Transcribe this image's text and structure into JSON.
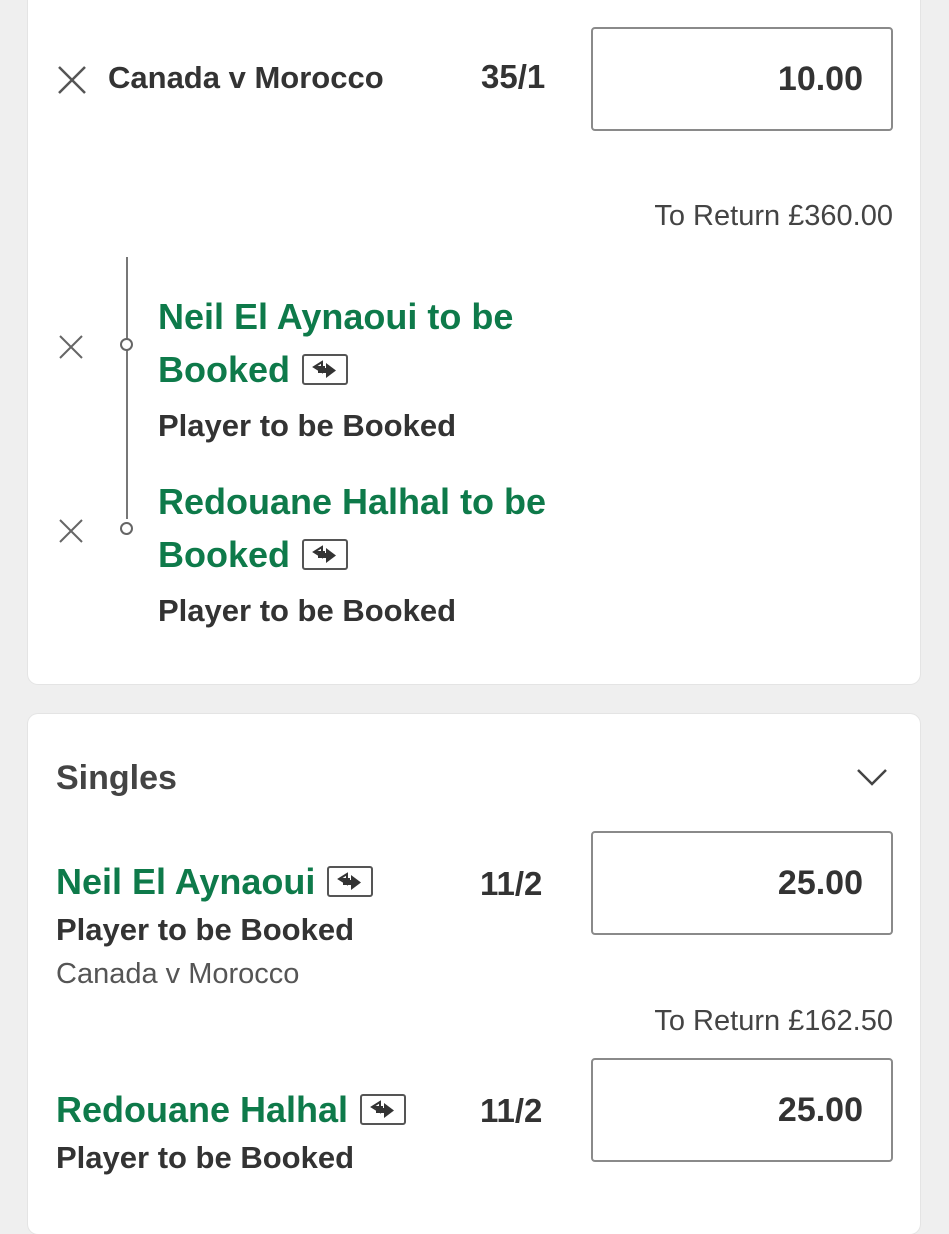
{
  "multiple": {
    "title": "Canada v Morocco",
    "odds": "35/1",
    "stake": "10.00",
    "to_return": "To Return £360.00",
    "legs": [
      {
        "name_line1": "Neil El Aynaoui to be",
        "name_line2": "Booked",
        "market": "Player to be Booked"
      },
      {
        "name_line1": "Redouane Halhal to be",
        "name_line2": "Booked",
        "market": "Player to be Booked"
      }
    ]
  },
  "singles": {
    "title": "Singles",
    "items": [
      {
        "name": "Neil El Aynaoui",
        "odds": "11/2",
        "stake": "25.00",
        "market": "Player to be Booked",
        "event": "Canada v Morocco",
        "to_return": "To Return £162.50"
      },
      {
        "name": "Redouane Halhal",
        "odds": "11/2",
        "stake": "25.00",
        "market": "Player to be Booked"
      }
    ]
  },
  "colors": {
    "accent_green": "#0e7a4a",
    "text_dark": "#333333",
    "background": "#efefef"
  }
}
